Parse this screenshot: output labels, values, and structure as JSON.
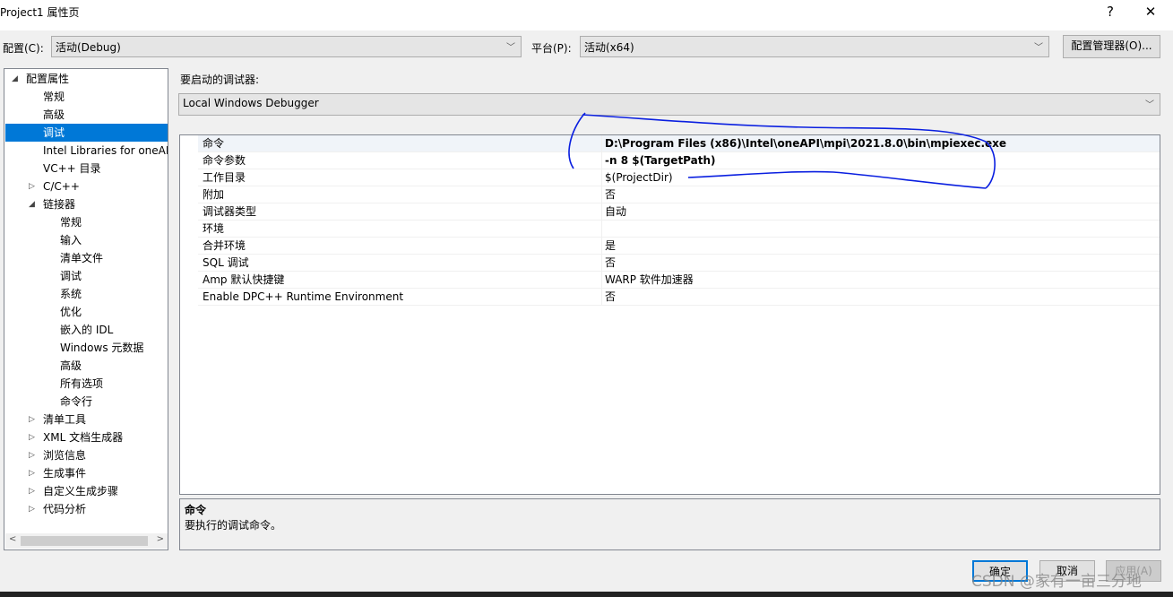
{
  "window": {
    "title": "Project1 属性页",
    "help": "?",
    "close": "✕"
  },
  "config": {
    "label": "配置(C):",
    "value": "活动(Debug)",
    "platform_label": "平台(P):",
    "platform_value": "活动(x64)",
    "manager_button": "配置管理器(O)..."
  },
  "tree": [
    {
      "label": "配置属性",
      "level": 0,
      "expander": "expanded"
    },
    {
      "label": "常规",
      "level": 1
    },
    {
      "label": "高级",
      "level": 1
    },
    {
      "label": "调试",
      "level": 1,
      "selected": true
    },
    {
      "label": "Intel Libraries for oneAPI",
      "level": 1
    },
    {
      "label": "VC++ 目录",
      "level": 1
    },
    {
      "label": "C/C++",
      "level": 1,
      "expander": "collapsed"
    },
    {
      "label": "链接器",
      "level": 1,
      "expander": "expanded"
    },
    {
      "label": "常规",
      "level": 2
    },
    {
      "label": "输入",
      "level": 2
    },
    {
      "label": "清单文件",
      "level": 2
    },
    {
      "label": "调试",
      "level": 2
    },
    {
      "label": "系统",
      "level": 2
    },
    {
      "label": "优化",
      "level": 2
    },
    {
      "label": "嵌入的 IDL",
      "level": 2
    },
    {
      "label": "Windows 元数据",
      "level": 2
    },
    {
      "label": "高级",
      "level": 2
    },
    {
      "label": "所有选项",
      "level": 2
    },
    {
      "label": "命令行",
      "level": 2
    },
    {
      "label": "清单工具",
      "level": 1,
      "expander": "collapsed"
    },
    {
      "label": "XML 文档生成器",
      "level": 1,
      "expander": "collapsed"
    },
    {
      "label": "浏览信息",
      "level": 1,
      "expander": "collapsed"
    },
    {
      "label": "生成事件",
      "level": 1,
      "expander": "collapsed"
    },
    {
      "label": "自定义生成步骤",
      "level": 1,
      "expander": "collapsed"
    },
    {
      "label": "代码分析",
      "level": 1,
      "expander": "collapsed"
    }
  ],
  "debugger": {
    "label": "要启动的调试器:",
    "value": "Local Windows Debugger"
  },
  "properties": [
    {
      "name": "命令",
      "value": "D:\\Program Files (x86)\\Intel\\oneAPI\\mpi\\2021.8.0\\bin\\mpiexec.exe",
      "bold": true
    },
    {
      "name": "命令参数",
      "value": "-n 8 $(TargetPath)",
      "bold": true
    },
    {
      "name": "工作目录",
      "value": "$(ProjectDir)"
    },
    {
      "name": "附加",
      "value": "否"
    },
    {
      "name": "调试器类型",
      "value": "自动"
    },
    {
      "name": "环境",
      "value": ""
    },
    {
      "name": "合并环境",
      "value": "是"
    },
    {
      "name": "SQL 调试",
      "value": "否"
    },
    {
      "name": "Amp 默认快捷键",
      "value": "WARP 软件加速器"
    },
    {
      "name": "Enable DPC++ Runtime Environment",
      "value": "否"
    }
  ],
  "description": {
    "title": "命令",
    "text": "要执行的调试命令。"
  },
  "buttons": {
    "ok": "确定",
    "cancel": "取消",
    "apply": "应用(A)"
  },
  "watermark": "CSDN @家有一亩三分地",
  "annotation_color": "#0a1fe0"
}
